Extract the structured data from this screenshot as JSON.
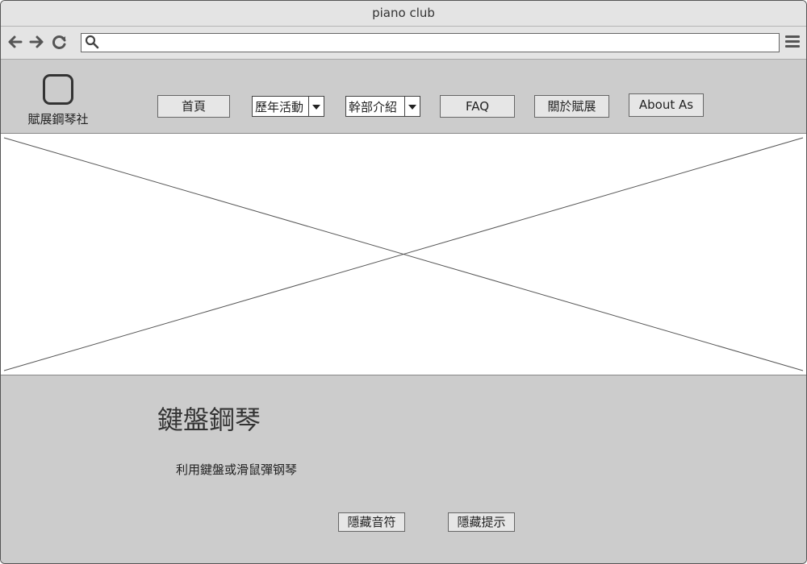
{
  "window": {
    "title": "piano club"
  },
  "toolbar": {
    "url": ""
  },
  "header": {
    "logo_text": "賦展鋼琴社",
    "nav": {
      "home": "首頁",
      "events": "歷年活動",
      "officers": "幹部介紹",
      "faq": "FAQ",
      "about_zh": "關於賦展",
      "about_en": "About As"
    }
  },
  "section": {
    "heading": "鍵盤鋼琴",
    "description": "利用鍵盤或滑鼠彈钢琴",
    "hide_notes": "隱藏音符",
    "hide_hints": "隱藏提示"
  }
}
